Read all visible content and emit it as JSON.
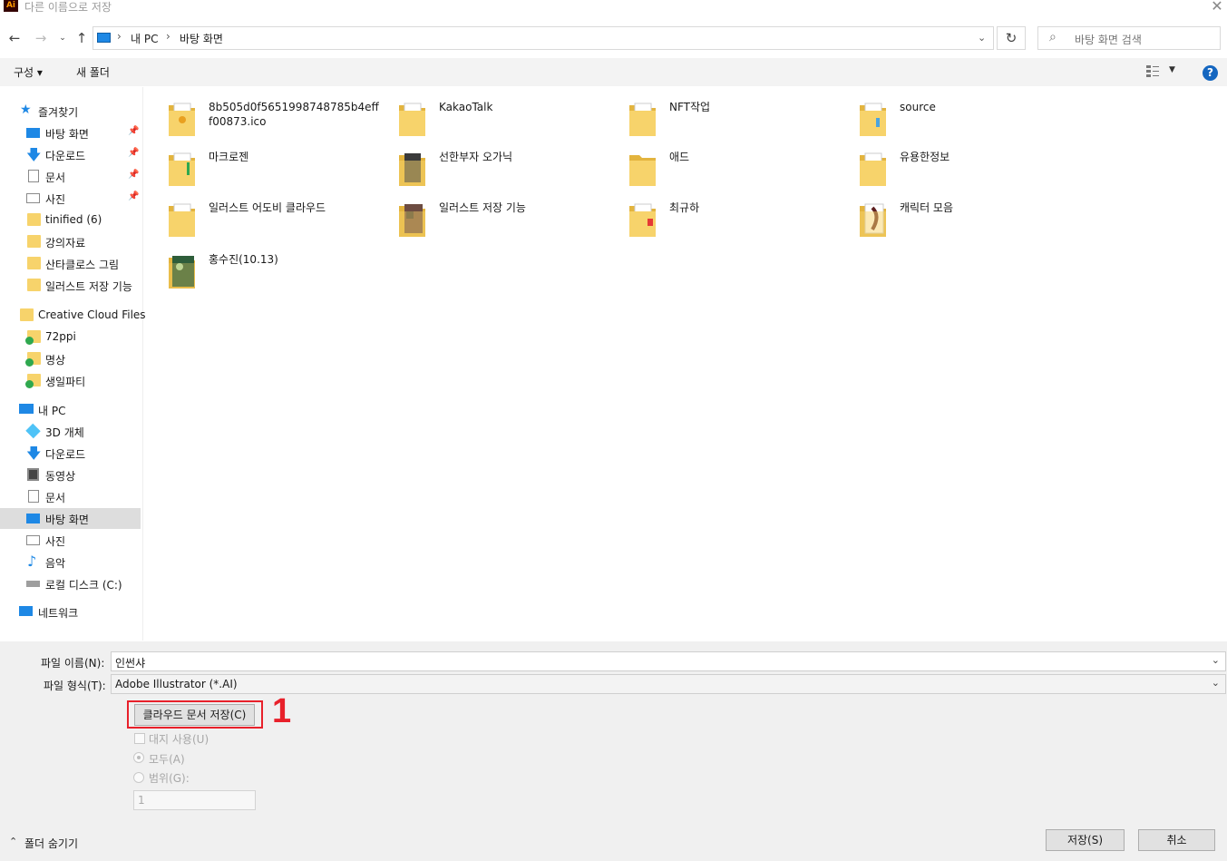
{
  "window": {
    "title": "다른 이름으로 저장",
    "app_icon": "Ai"
  },
  "nav": {
    "breadcrumb": [
      "내 PC",
      "바탕 화면"
    ],
    "search_placeholder": "바탕 화면 검색"
  },
  "toolbar": {
    "organize": "구성 ▾",
    "new_folder": "새 폴더"
  },
  "sidebar": {
    "quick_access": {
      "label": "즐겨찾기",
      "items": [
        "바탕 화면",
        "다운로드",
        "문서",
        "사진",
        "tinified (6)",
        "강의자료",
        "산타클로스 그림",
        "일러스트 저장 기능"
      ]
    },
    "creative_cloud": {
      "label": "Creative Cloud Files",
      "items": [
        "72ppi",
        "명상",
        "생일파티"
      ]
    },
    "this_pc": {
      "label": "내 PC",
      "items": [
        "3D 개체",
        "다운로드",
        "동영상",
        "문서",
        "바탕 화면",
        "사진",
        "음악",
        "로컬 디스크 (C:)"
      ]
    },
    "network": {
      "label": "네트워크"
    }
  },
  "files": [
    {
      "name": "8b505d0f5651998748785b4efff00873.ico"
    },
    {
      "name": "KakaoTalk"
    },
    {
      "name": "NFT작업"
    },
    {
      "name": "source"
    },
    {
      "name": "마크로젠"
    },
    {
      "name": "선한부자 오가닉"
    },
    {
      "name": "애드"
    },
    {
      "name": "유용한정보"
    },
    {
      "name": "일러스트 어도비 클라우드"
    },
    {
      "name": "일러스트 저장 기능"
    },
    {
      "name": "최규하"
    },
    {
      "name": "캐릭터 모음"
    },
    {
      "name": "홍수진(10.13)"
    }
  ],
  "form": {
    "filename_label": "파일 이름(N):",
    "filename_value": "인썬샤",
    "filetype_label": "파일 형식(T):",
    "filetype_value": "Adobe Illustrator (*.AI)",
    "cloud_button": "클라우드 문서 저장(C)",
    "annotation": "1",
    "use_artboards": "대지 사용(U)",
    "all_label": "모두(A)",
    "range_label": "범위(G):",
    "range_value": "1",
    "hide_folders": "폴더 숨기기",
    "save": "저장(S)",
    "cancel": "취소"
  },
  "colors": {
    "accent": "#1e88e5",
    "highlight": "#e8202a",
    "selected": "#dddddd",
    "folder": "#f7d36b"
  }
}
